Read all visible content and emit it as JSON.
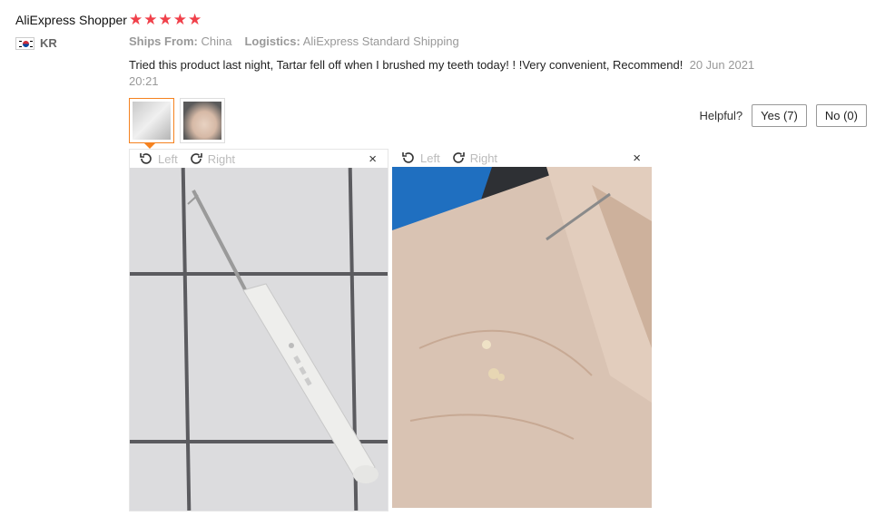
{
  "review": {
    "user_name": "AliExpress Shopper",
    "rating": 5,
    "country_code": "KR",
    "ships_from_label": "Ships From:",
    "ships_from_value": "China",
    "logistics_label": "Logistics:",
    "logistics_value": "AliExpress Standard Shipping",
    "text": "Tried this product last night, Tartar fell off when I brushed my teeth today! ! !Very convenient, Recommend!",
    "date": "20 Jun 2021 20:21"
  },
  "helpful": {
    "label": "Helpful?",
    "yes_label": "Yes (7)",
    "no_label": "No (0)"
  },
  "viewer": {
    "rotate_left_label": "Left",
    "rotate_right_label": "Right",
    "close_glyph": "×"
  },
  "icons": {
    "star": "★",
    "rotate_left": "rotate-left-icon",
    "rotate_right": "rotate-right-icon",
    "close": "close-icon"
  },
  "colors": {
    "star": "#f0404a",
    "active_thumb": "#f5821f"
  }
}
